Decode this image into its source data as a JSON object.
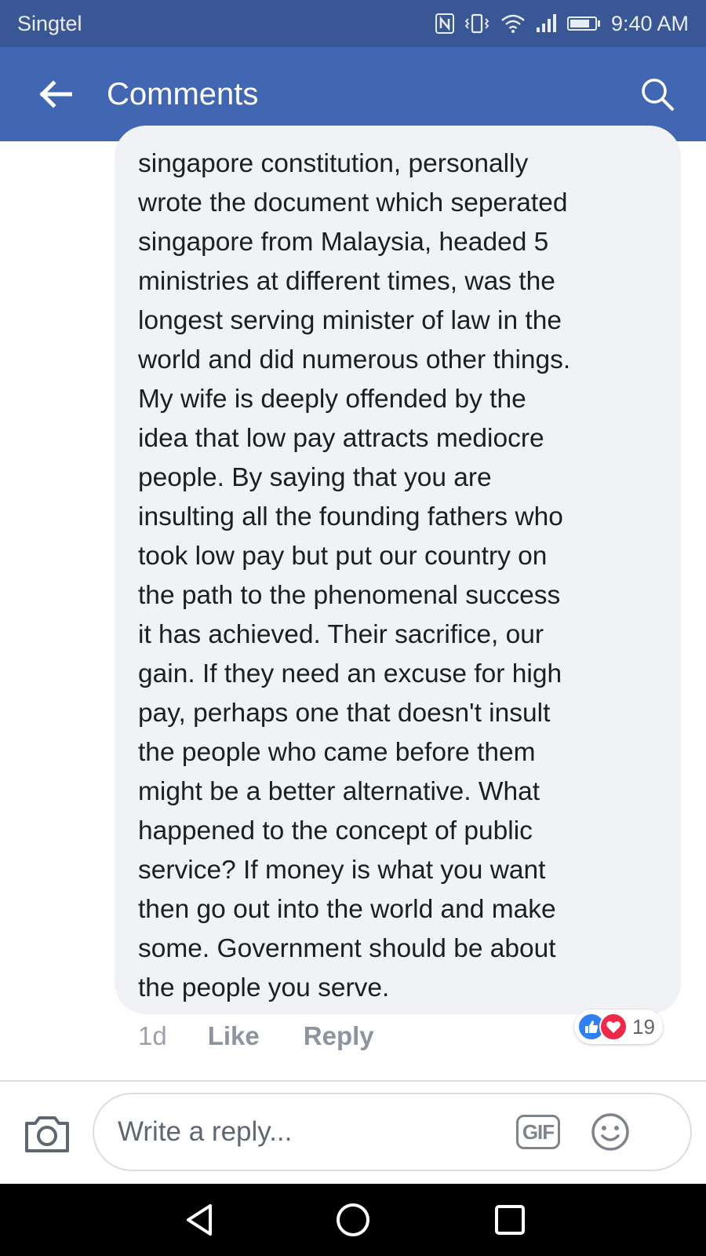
{
  "status_bar": {
    "carrier": "Singtel",
    "time": "9:40 AM",
    "battery_level": 0.8
  },
  "header": {
    "title": "Comments",
    "back_icon": "arrow-left-icon",
    "search_icon": "search-icon"
  },
  "comment": {
    "lines": [
      "singapore constitution, personally",
      "wrote the document which seperated",
      "singapore from Malaysia, headed 5",
      "ministries at different times, was the",
      "longest serving minister of law in the",
      "world and did numerous other things.",
      "My wife is deeply offended by the",
      "idea that low  pay attracts mediocre",
      "people. By saying that you are",
      "insulting all the founding fathers who",
      "took low pay but  put our country on",
      "the path to the phenomenal success",
      "it has achieved. Their sacrifice, our",
      "gain. If they need an excuse for high",
      "pay, perhaps one that doesn't insult",
      "the people who came before them",
      "might be a better alternative. What",
      "happened to the concept of public",
      "service? If money is what you want",
      "then go out into the world and make",
      "some. Government should be about",
      "the people you serve."
    ],
    "time_ago": "1d",
    "like_label": "Like",
    "reply_label": "Reply",
    "reaction_count": "19",
    "reaction_icons": [
      "like-reaction-icon",
      "love-reaction-icon"
    ]
  },
  "composer": {
    "placeholder": "Write a reply...",
    "value": "",
    "gif_label": "GIF",
    "camera_icon": "camera-icon",
    "emoji_icon": "emoji-icon"
  },
  "colors": {
    "status_bar_bg": "#3a5795",
    "app_bar_bg": "#4267b2",
    "bubble_bg": "#f1f2f6",
    "like_blue": "#2f80f2",
    "love_red": "#f0284a"
  }
}
